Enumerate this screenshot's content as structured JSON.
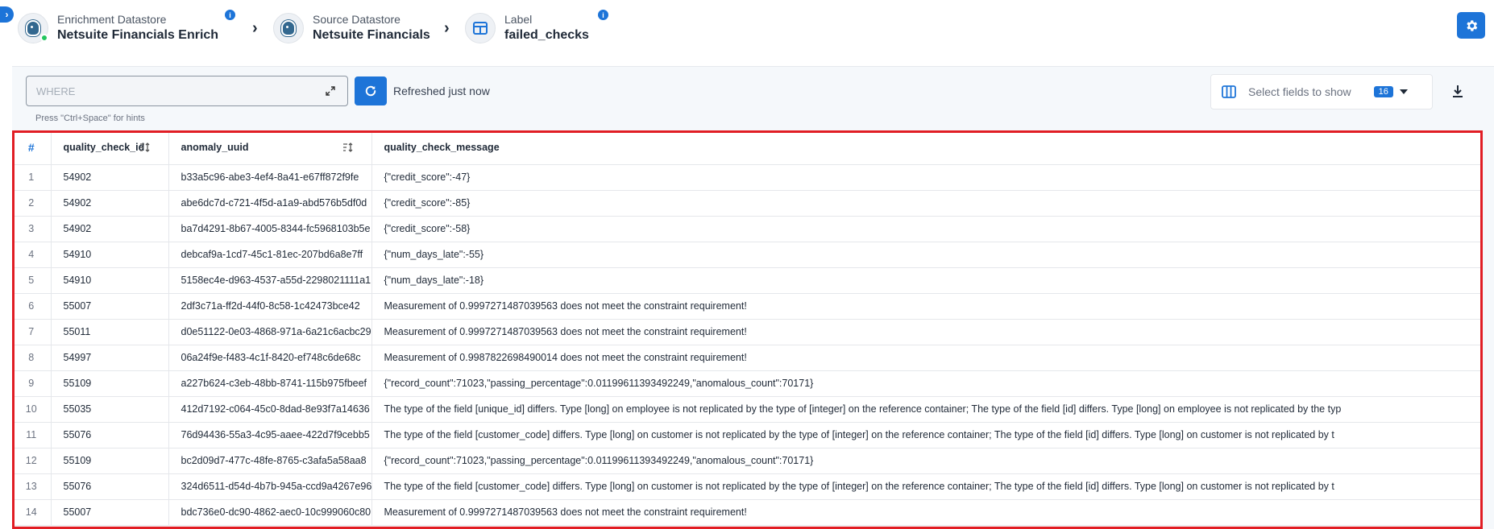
{
  "breadcrumb": {
    "enrichment": {
      "sub": "Enrichment Datastore",
      "main": "Netsuite Financials Enrich"
    },
    "source": {
      "sub": "Source Datastore",
      "main": "Netsuite Financials"
    },
    "label": {
      "sub": "Label",
      "main": "failed_checks"
    }
  },
  "toolbar": {
    "where_placeholder": "WHERE",
    "hint": "Press \"Ctrl+Space\" for hints",
    "refreshed": "Refreshed just now",
    "select_fields_label": "Select fields to show",
    "fields_count": "16"
  },
  "table": {
    "headers": [
      "#",
      "quality_check_id",
      "anomaly_uuid",
      "quality_check_message"
    ],
    "rows": [
      [
        "1",
        "54902",
        "b33a5c96-abe3-4ef4-8a41-e67ff872f9fe",
        "{\"credit_score\":-47}"
      ],
      [
        "2",
        "54902",
        "abe6dc7d-c721-4f5d-a1a9-abd576b5df0d",
        "{\"credit_score\":-85}"
      ],
      [
        "3",
        "54902",
        "ba7d4291-8b67-4005-8344-fc5968103b5e",
        "{\"credit_score\":-58}"
      ],
      [
        "4",
        "54910",
        "debcaf9a-1cd7-45c1-81ec-207bd6a8e7ff",
        "{\"num_days_late\":-55}"
      ],
      [
        "5",
        "54910",
        "5158ec4e-d963-4537-a55d-2298021111a1",
        "{\"num_days_late\":-18}"
      ],
      [
        "6",
        "55007",
        "2df3c71a-ff2d-44f0-8c58-1c42473bce42",
        "Measurement of 0.9997271487039563 does not meet the constraint requirement!"
      ],
      [
        "7",
        "55011",
        "d0e51122-0e03-4868-971a-6a21c6acbc29",
        "Measurement of 0.9997271487039563 does not meet the constraint requirement!"
      ],
      [
        "8",
        "54997",
        "06a24f9e-f483-4c1f-8420-ef748c6de68c",
        "Measurement of 0.9987822698490014 does not meet the constraint requirement!"
      ],
      [
        "9",
        "55109",
        "a227b624-c3eb-48bb-8741-115b975fbeef",
        "{\"record_count\":71023,\"passing_percentage\":0.01199611393492249,\"anomalous_count\":70171}"
      ],
      [
        "10",
        "55035",
        "412d7192-c064-45c0-8dad-8e93f7a14636",
        "The type of the field [unique_id] differs. Type [long] on employee is not replicated by the type of [integer] on the reference container; The type of the field [id] differs. Type [long] on employee is not replicated by the typ"
      ],
      [
        "11",
        "55076",
        "76d94436-55a3-4c95-aaee-422d7f9cebb5",
        "The type of the field [customer_code] differs. Type [long] on customer is not replicated by the type of [integer] on the reference container; The type of the field [id] differs. Type [long] on customer is not replicated by t"
      ],
      [
        "12",
        "55109",
        "bc2d09d7-477c-48fe-8765-c3afa5a58aa8",
        "{\"record_count\":71023,\"passing_percentage\":0.01199611393492249,\"anomalous_count\":70171}"
      ],
      [
        "13",
        "55076",
        "324d6511-d54d-4b7b-945a-ccd9a4267e96",
        "The type of the field [customer_code] differs. Type [long] on customer is not replicated by the type of [integer] on the reference container; The type of the field [id] differs. Type [long] on customer is not replicated by t"
      ],
      [
        "14",
        "55007",
        "bdc736e0-dc90-4862-aec0-10c999060c80",
        "Measurement of 0.9997271487039563 does not meet the constraint requirement!"
      ]
    ]
  },
  "colors": {
    "accent": "#1d74d8",
    "highlight": "#e11d24",
    "status_ok": "#22c55e"
  }
}
